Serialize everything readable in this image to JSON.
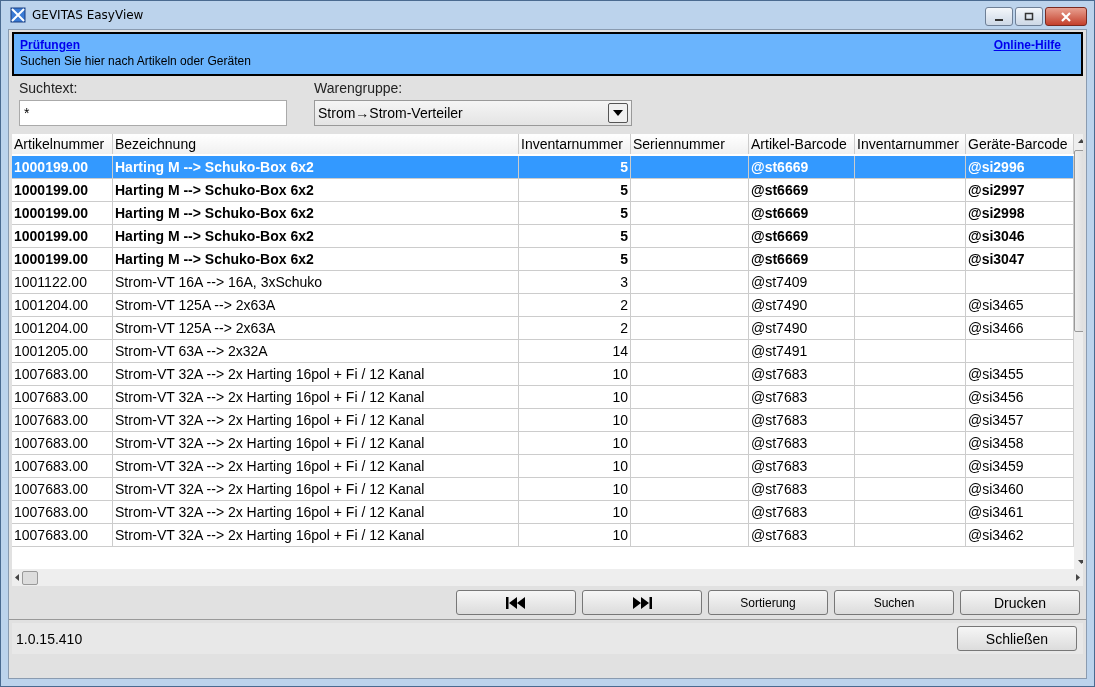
{
  "window": {
    "title": "GEVITAS EasyView"
  },
  "header": {
    "link": "Prüfungen",
    "help_link": "Online-Hilfe",
    "description": "Suchen Sie hier nach Artikeln oder Geräten"
  },
  "search": {
    "label": "Suchtext:",
    "value": "*"
  },
  "group": {
    "label": "Warengruppe:",
    "value": "Strom→Strom-Verteiler"
  },
  "table": {
    "columns": [
      "Artikelnummer",
      "Bezeichnung",
      "Inventarnummer",
      "Seriennummer",
      "Artikel-Barcode",
      "Inventarnummer",
      "Geräte-Barcode"
    ],
    "rows": [
      {
        "selected": true,
        "bold": true,
        "cells": [
          "1000199.00",
          "Harting M --> Schuko-Box 6x2",
          "5",
          "",
          "@st6669",
          "",
          "@si2996"
        ]
      },
      {
        "selected": false,
        "bold": true,
        "cells": [
          "1000199.00",
          "Harting M --> Schuko-Box 6x2",
          "5",
          "",
          "@st6669",
          "",
          "@si2997"
        ]
      },
      {
        "selected": false,
        "bold": true,
        "cells": [
          "1000199.00",
          "Harting M --> Schuko-Box 6x2",
          "5",
          "",
          "@st6669",
          "",
          "@si2998"
        ]
      },
      {
        "selected": false,
        "bold": true,
        "cells": [
          "1000199.00",
          "Harting M --> Schuko-Box 6x2",
          "5",
          "",
          "@st6669",
          "",
          "@si3046"
        ]
      },
      {
        "selected": false,
        "bold": true,
        "cells": [
          "1000199.00",
          "Harting M --> Schuko-Box 6x2",
          "5",
          "",
          "@st6669",
          "",
          "@si3047"
        ]
      },
      {
        "selected": false,
        "bold": false,
        "cells": [
          "1001122.00",
          "Strom-VT 16A --> 16A, 3xSchuko",
          "3",
          "",
          "@st7409",
          "",
          ""
        ]
      },
      {
        "selected": false,
        "bold": false,
        "cells": [
          "1001204.00",
          "Strom-VT 125A --> 2x63A",
          "2",
          "",
          "@st7490",
          "",
          "@si3465"
        ]
      },
      {
        "selected": false,
        "bold": false,
        "cells": [
          "1001204.00",
          "Strom-VT 125A --> 2x63A",
          "2",
          "",
          "@st7490",
          "",
          "@si3466"
        ]
      },
      {
        "selected": false,
        "bold": false,
        "cells": [
          "1001205.00",
          "Strom-VT 63A --> 2x32A",
          "14",
          "",
          "@st7491",
          "",
          ""
        ]
      },
      {
        "selected": false,
        "bold": false,
        "cells": [
          "1007683.00",
          "Strom-VT 32A --> 2x Harting 16pol + Fi / 12 Kanal",
          "10",
          "",
          "@st7683",
          "",
          "@si3455"
        ]
      },
      {
        "selected": false,
        "bold": false,
        "cells": [
          "1007683.00",
          "Strom-VT 32A --> 2x Harting 16pol + Fi / 12 Kanal",
          "10",
          "",
          "@st7683",
          "",
          "@si3456"
        ]
      },
      {
        "selected": false,
        "bold": false,
        "cells": [
          "1007683.00",
          "Strom-VT 32A --> 2x Harting 16pol + Fi / 12 Kanal",
          "10",
          "",
          "@st7683",
          "",
          "@si3457"
        ]
      },
      {
        "selected": false,
        "bold": false,
        "cells": [
          "1007683.00",
          "Strom-VT 32A --> 2x Harting 16pol + Fi / 12 Kanal",
          "10",
          "",
          "@st7683",
          "",
          "@si3458"
        ]
      },
      {
        "selected": false,
        "bold": false,
        "cells": [
          "1007683.00",
          "Strom-VT 32A --> 2x Harting 16pol + Fi / 12 Kanal",
          "10",
          "",
          "@st7683",
          "",
          "@si3459"
        ]
      },
      {
        "selected": false,
        "bold": false,
        "cells": [
          "1007683.00",
          "Strom-VT 32A --> 2x Harting 16pol + Fi / 12 Kanal",
          "10",
          "",
          "@st7683",
          "",
          "@si3460"
        ]
      },
      {
        "selected": false,
        "bold": false,
        "cells": [
          "1007683.00",
          "Strom-VT 32A --> 2x Harting 16pol + Fi / 12 Kanal",
          "10",
          "",
          "@st7683",
          "",
          "@si3461"
        ]
      },
      {
        "selected": false,
        "bold": false,
        "cells": [
          "1007683.00",
          "Strom-VT 32A --> 2x Harting 16pol + Fi / 12 Kanal",
          "10",
          "",
          "@st7683",
          "",
          "@si3462"
        ]
      }
    ]
  },
  "buttons": [
    {
      "kind": "first"
    },
    {
      "kind": "last"
    },
    {
      "kind": "text",
      "label": "Sortierung"
    },
    {
      "kind": "text",
      "label": "Suchen"
    },
    {
      "kind": "text",
      "label": "Drucken",
      "large": true
    }
  ],
  "status_bar": {
    "version": "1.0.15.410",
    "close_button": "Schließen"
  }
}
